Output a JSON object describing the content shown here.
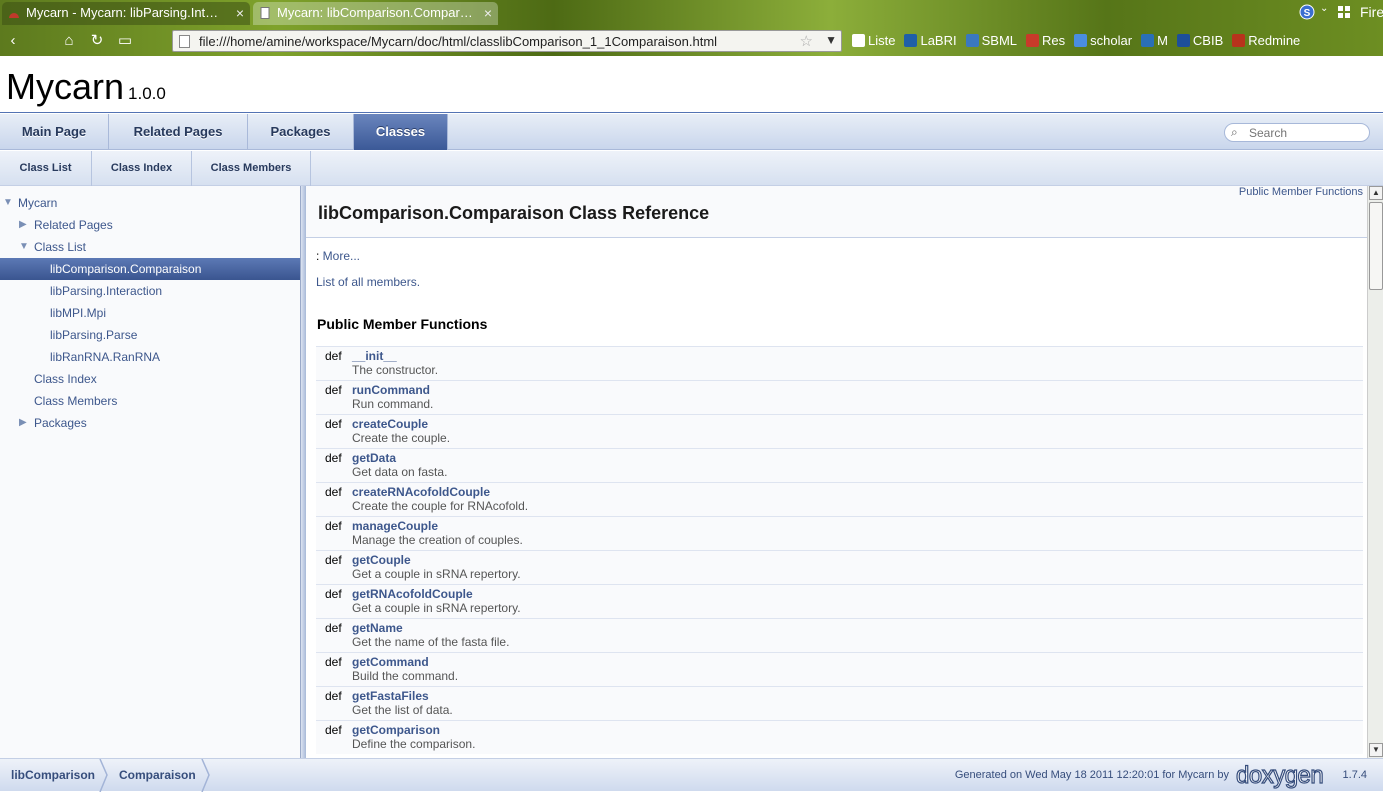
{
  "browser": {
    "tabs": [
      {
        "title": "Mycarn - Mycarn: libParsing.Int…",
        "close": "×"
      },
      {
        "title": "Mycarn: libComparison.Compar…",
        "close": "×"
      }
    ],
    "app_name": "Firefox",
    "url": "file:///home/amine/workspace/Mycarn/doc/html/classlibComparison_1_1Comparaison.html",
    "bookmarks": [
      {
        "label": "Liste",
        "icon": "page-icon",
        "color": "#ffffff"
      },
      {
        "label": "LaBRI",
        "icon": "labri-icon",
        "color": "#1e5fa8"
      },
      {
        "label": "SBML",
        "icon": "sbml-icon",
        "color": "#3a78c0"
      },
      {
        "label": "Res",
        "icon": "gf-icon",
        "color": "#c83a2a"
      },
      {
        "label": "scholar",
        "icon": "google-icon",
        "color": "#4a8de0"
      },
      {
        "label": "M",
        "icon": "m-icon",
        "color": "#2a6fb8"
      },
      {
        "label": "CBIB",
        "icon": "cbib-icon",
        "color": "#1d4f9a"
      },
      {
        "label": "Redmine",
        "icon": "redmine-icon",
        "color": "#b8331c"
      }
    ]
  },
  "project": {
    "name": "Mycarn",
    "number": "1.0.0"
  },
  "main_tabs": [
    "Main Page",
    "Related Pages",
    "Packages",
    "Classes"
  ],
  "active_main_tab": "Classes",
  "search": {
    "placeholder": "Search",
    "icon": "search-icon"
  },
  "sub_tabs": [
    "Class List",
    "Class Index",
    "Class Members"
  ],
  "tree": [
    {
      "label": "Mycarn",
      "expander": "expanded"
    },
    {
      "label": "Related Pages",
      "expander": "collapsed"
    },
    {
      "label": "Class List",
      "expander": "expanded"
    },
    {
      "label": "libComparison.Comparaison",
      "expander": "none",
      "selected": true
    },
    {
      "label": "libParsing.Interaction",
      "expander": "none"
    },
    {
      "label": "libMPI.Mpi",
      "expander": "none"
    },
    {
      "label": "libParsing.Parse",
      "expander": "none"
    },
    {
      "label": "libRanRNA.RanRNA",
      "expander": "none"
    },
    {
      "label": "Class Index",
      "expander": "none"
    },
    {
      "label": "Class Members",
      "expander": "none"
    },
    {
      "label": "Packages",
      "expander": "collapsed"
    }
  ],
  "content": {
    "summary_link": "Public Member Functions",
    "title": "libComparison.Comparaison Class Reference",
    "more_prefix": ": ",
    "more_link": "More...",
    "all_members_link": "List of all members.",
    "section_title": "Public Member Functions",
    "keyword": "def",
    "members": [
      {
        "name": "__init__",
        "desc": "The constructor."
      },
      {
        "name": "runCommand",
        "desc": "Run command."
      },
      {
        "name": "createCouple",
        "desc": "Create the couple."
      },
      {
        "name": "getData",
        "desc": "Get data on fasta."
      },
      {
        "name": "createRNAcofoldCouple",
        "desc": "Create the couple for RNAcofold."
      },
      {
        "name": "manageCouple",
        "desc": "Manage the creation of couples."
      },
      {
        "name": "getCouple",
        "desc": "Get a couple in sRNA repertory."
      },
      {
        "name": "getRNAcofoldCouple",
        "desc": "Get a couple in sRNA repertory."
      },
      {
        "name": "getName",
        "desc": "Get the name of the fasta file."
      },
      {
        "name": "getCommand",
        "desc": "Build the command."
      },
      {
        "name": "getFastaFiles",
        "desc": "Get the list of data."
      },
      {
        "name": "getComparison",
        "desc": "Define the comparison."
      }
    ]
  },
  "footer": {
    "breadcrumbs": [
      "libComparison",
      "Comparaison"
    ],
    "generated_text": "Generated on Wed May 18 2011 12:20:01 for Mycarn by",
    "logo_text": "doxygen",
    "version": "1.7.4"
  }
}
